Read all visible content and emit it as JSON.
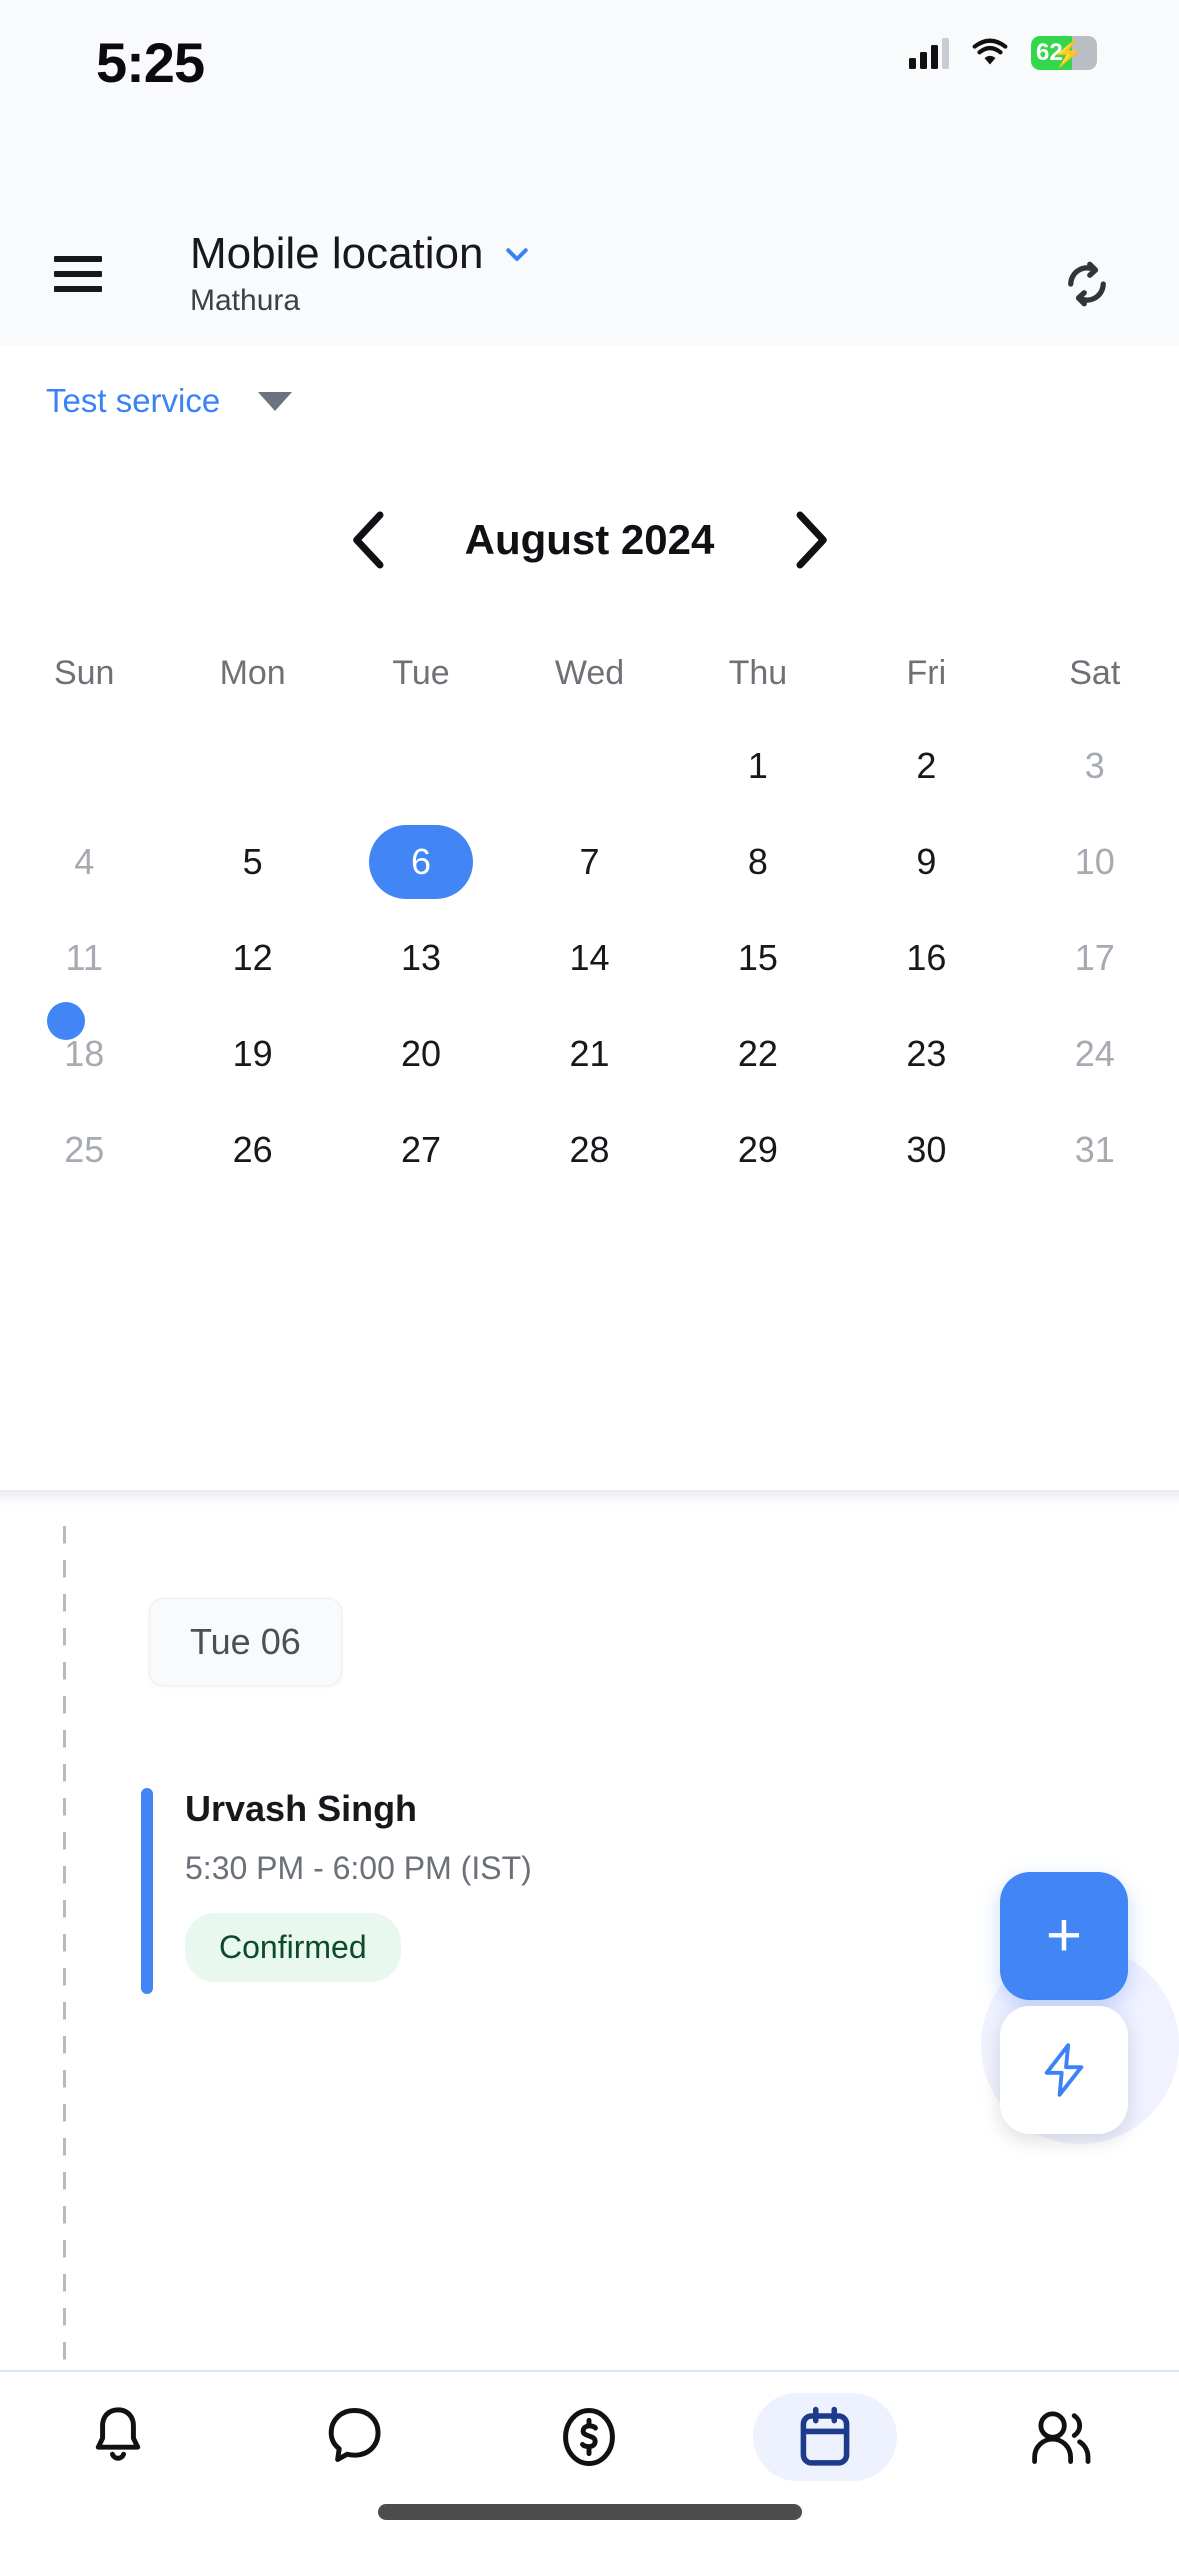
{
  "status_bar": {
    "time": "5:25",
    "battery_percent": "62",
    "battery_level": 62,
    "signal_icon": "cellular-signal-icon",
    "wifi_icon": "wifi-icon",
    "battery_icon": "battery-charging-icon",
    "battery_color": "#32d74b"
  },
  "header": {
    "menu_icon": "hamburger-menu-icon",
    "title": "Mobile location",
    "subtitle": "Mathura",
    "dropdown_icon": "chevron-down-icon",
    "refresh_icon": "refresh-sync-icon",
    "accent_color": "#3b82f6"
  },
  "service_filter": {
    "label": "Test service",
    "caret_icon": "caret-down-icon"
  },
  "month_nav": {
    "prev_icon": "chevron-left-icon",
    "next_icon": "chevron-right-icon",
    "title": "August 2024"
  },
  "calendar": {
    "weekdays": [
      "Sun",
      "Mon",
      "Tue",
      "Wed",
      "Thu",
      "Fri",
      "Sat"
    ],
    "selected_day": 6,
    "selected_color": "#4285f4",
    "weeks": [
      [
        null,
        null,
        null,
        null,
        1,
        2,
        3
      ],
      [
        4,
        5,
        6,
        7,
        8,
        9,
        10
      ],
      [
        11,
        12,
        13,
        14,
        15,
        16,
        17
      ],
      [
        18,
        19,
        20,
        21,
        22,
        23,
        24
      ],
      [
        25,
        26,
        27,
        28,
        29,
        30,
        31
      ]
    ]
  },
  "timeline": {
    "date_chip": "Tue 06",
    "dot_color": "#4285f4",
    "appointment": {
      "name": "Urvash  Singh",
      "time": "5:30 PM - 6:00 PM (IST)",
      "status": "Confirmed",
      "status_bg": "#e8f8ee",
      "status_color": "#0b4a2b",
      "accent_color": "#4285f4"
    }
  },
  "fabs": {
    "add_icon": "plus-icon",
    "add_label": "+",
    "quick_icon": "lightning-bolt-icon"
  },
  "bottom_nav": {
    "active_index": 3,
    "items": [
      {
        "name": "notifications",
        "icon": "bell-icon"
      },
      {
        "name": "messages",
        "icon": "chat-bubble-icon"
      },
      {
        "name": "payments",
        "icon": "dollar-circle-icon"
      },
      {
        "name": "calendar",
        "icon": "calendar-icon"
      },
      {
        "name": "clients",
        "icon": "people-icon"
      }
    ]
  }
}
